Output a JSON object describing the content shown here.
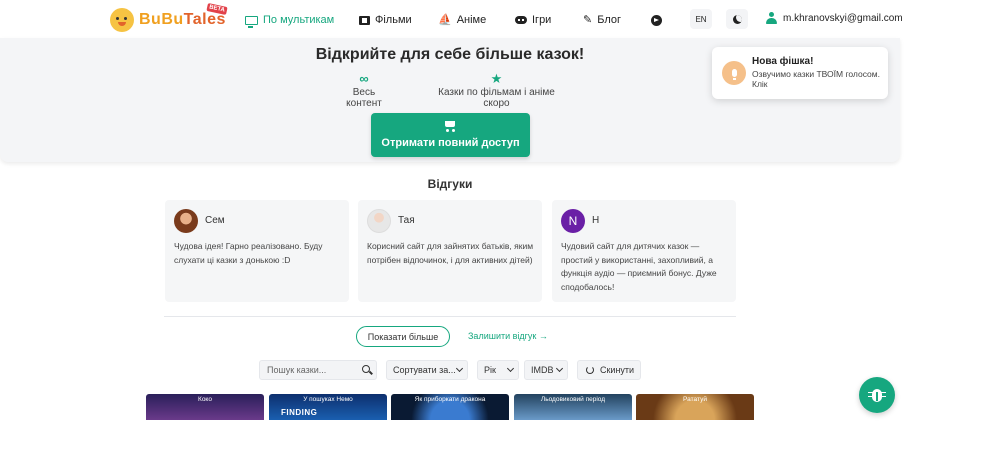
{
  "header": {
    "logo": {
      "text_part1": "BuBu",
      "text_part2": "Tales",
      "badge": "BETA"
    },
    "nav": [
      {
        "label": "По мультикам",
        "icon": "tv-icon",
        "active": true
      },
      {
        "label": "Фільми",
        "icon": "film-icon",
        "active": false
      },
      {
        "label": "Аніме",
        "icon": "anime-icon",
        "active": false
      },
      {
        "label": "Ігри",
        "icon": "gamepad-icon",
        "active": false
      },
      {
        "label": "Блог",
        "icon": "blog-icon",
        "active": false
      },
      {
        "label": "",
        "icon": "telegram-icon",
        "active": false
      }
    ],
    "lang": "EN",
    "theme_icon": "moon-icon",
    "user_email": "m.khranovskyi@gmail.com"
  },
  "promo": {
    "title": "Відкрийте для себе більше казок!",
    "features": [
      {
        "icon": "infinity-icon",
        "glyph": "∞",
        "label": "Весь контент"
      },
      {
        "icon": "star-icon",
        "glyph": "★",
        "label": "Казки по фільмам і аніме скоро"
      }
    ],
    "cta_label": "Отримати повний доступ"
  },
  "toast": {
    "title": "Нова фішка!",
    "text": "Озвучимо казки ТВОЇМ голосом. Клік"
  },
  "reviews": {
    "title": "Відгуки",
    "items": [
      {
        "name": "Сем",
        "avatar": "photo",
        "initial": "",
        "text": "Чудова ідея! Гарно реалізовано. Буду слухати ці казки з донькою :D"
      },
      {
        "name": "Тая",
        "avatar": "photo",
        "initial": "",
        "text": "Корисний сайт для зайнятих батьків, яким потрібен відпочинок, і для активних дітей)"
      },
      {
        "name": "Н",
        "avatar": "letter",
        "initial": "N",
        "text": "Чудовий сайт для дитячих казок — простий у використанні, захопливий, а функція аудіо — приємний бонус. Дуже сподобалось!"
      }
    ],
    "show_more": "Показати більше",
    "leave_review": "Залишити відгук →"
  },
  "filters": {
    "search_placeholder": "Пошук казки...",
    "sort": "Сортувати за...",
    "year": "Рік",
    "rating": "IMDB",
    "reset": "Скинути"
  },
  "movies": [
    {
      "label": "Коко",
      "title": "",
      "color": "#3b2a6b"
    },
    {
      "label": "У пошуках Немо",
      "title": "FINDING",
      "color": "#0f3f8a"
    },
    {
      "label": "Як приборкати дракона",
      "title": "",
      "color": "#0b2340"
    },
    {
      "label": "Льодовиковий період",
      "title": "",
      "color": "#3b6fa8"
    },
    {
      "label": "Рататуй",
      "title": "",
      "color": "#8a4a1d"
    }
  ],
  "colors": {
    "accent": "#16a77f"
  }
}
